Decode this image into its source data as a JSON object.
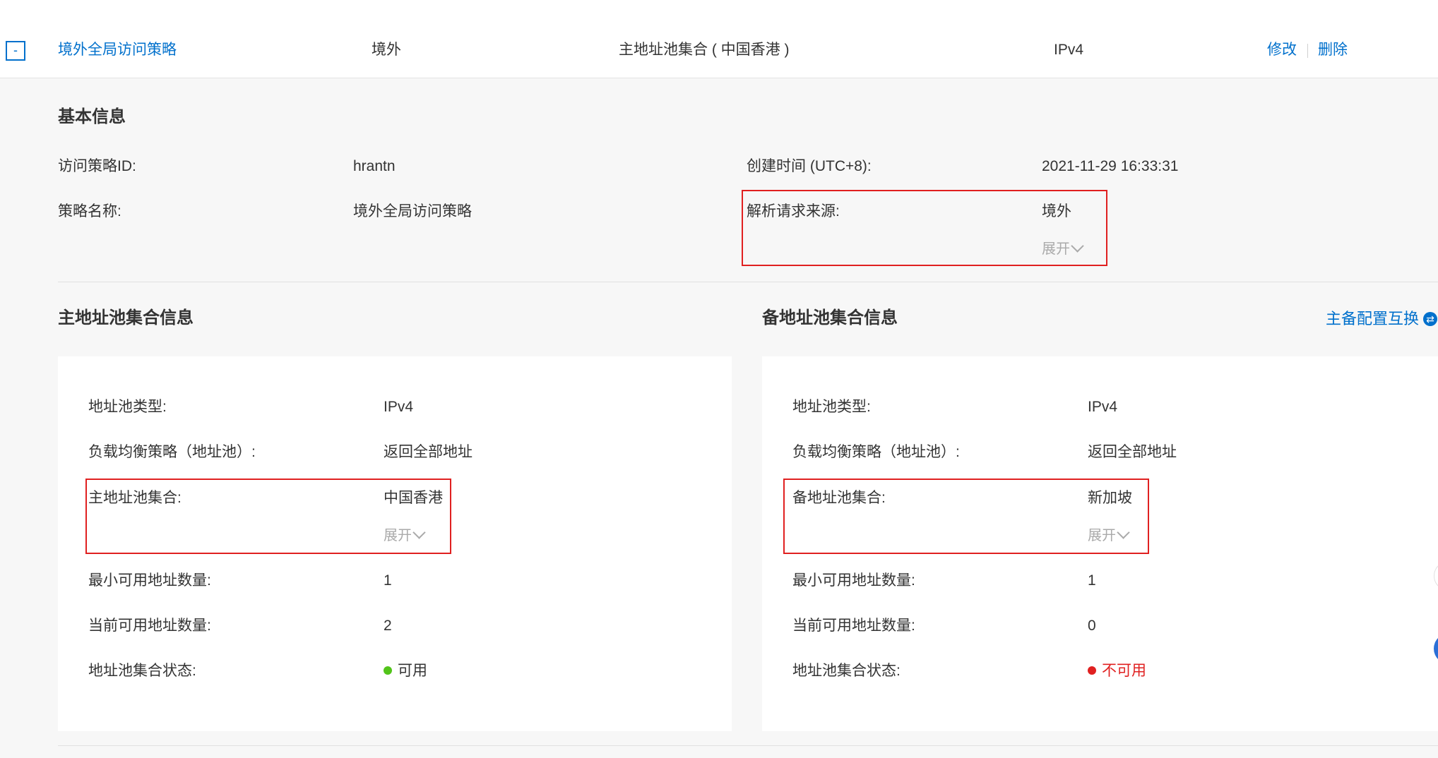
{
  "header_row": {
    "toggle": "-",
    "policy_name": "境外全局访问策略",
    "source": "境外",
    "pool_set": "主地址池集合 ( 中国香港 )",
    "type": "IPv4",
    "edit": "修改",
    "delete": "删除"
  },
  "basic": {
    "title": "基本信息",
    "id_label": "访问策略ID:",
    "id_value": "hrantn",
    "created_label": "创建时间 (UTC+8):",
    "created_value": "2021-11-29 16:33:31",
    "name_label": "策略名称:",
    "name_value": "境外全局访问策略",
    "source_label": "解析请求来源:",
    "source_value": "境外",
    "expand": "展开"
  },
  "primary": {
    "title": "主地址池集合信息",
    "type_label": "地址池类型:",
    "type_value": "IPv4",
    "lb_label": "负载均衡策略（地址池）:",
    "lb_value": "返回全部地址",
    "set_label": "主地址池集合:",
    "set_value": "中国香港",
    "expand": "展开",
    "min_label": "最小可用地址数量:",
    "min_value": "1",
    "cur_label": "当前可用地址数量:",
    "cur_value": "2",
    "status_label": "地址池集合状态:",
    "status_value": "可用",
    "status_color": "#52c41a"
  },
  "backup": {
    "title": "备地址池集合信息",
    "swap": "主备配置互换",
    "type_label": "地址池类型:",
    "type_value": "IPv4",
    "lb_label": "负载均衡策略（地址池）:",
    "lb_value": "返回全部地址",
    "set_label": "备地址池集合:",
    "set_value": "新加坡",
    "expand": "展开",
    "min_label": "最小可用地址数量:",
    "min_value": "1",
    "cur_label": "当前可用地址数量:",
    "cur_value": "0",
    "status_label": "地址池集合状态:",
    "status_value": "不可用",
    "status_color": "#e02020"
  }
}
